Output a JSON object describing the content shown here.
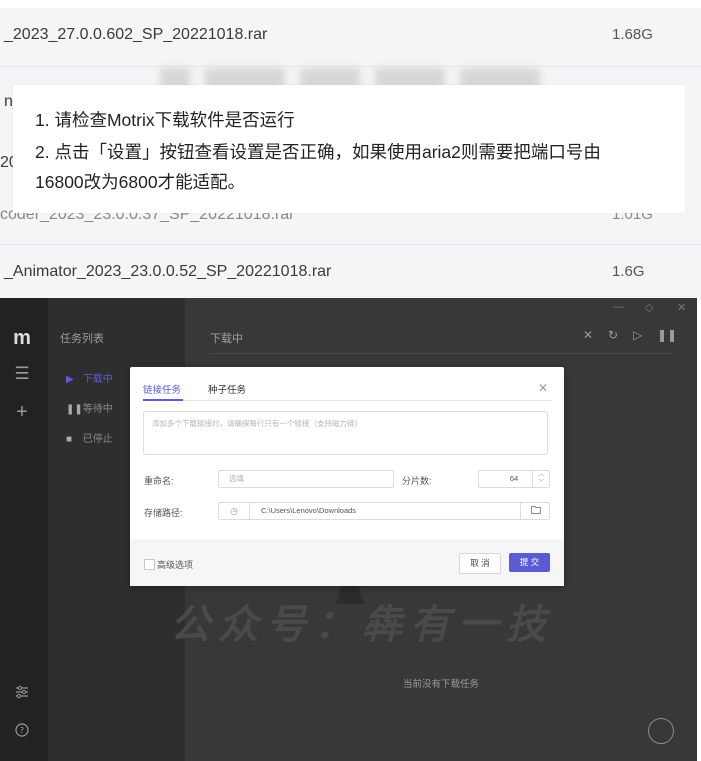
{
  "file_list": {
    "rows": [
      {
        "name": "_2023_27.0.0.602_SP_20221018.rar",
        "size": "1.68G"
      },
      {
        "name": "n_",
        "size": ""
      },
      {
        "name": "20",
        "size": ""
      },
      {
        "name": "coder_2023_23.0.0.37_SP_20221018.rar",
        "size": "1.01G"
      },
      {
        "name": "_Animator_2023_23.0.0.52_SP_20221018.rar",
        "size": "1.6G"
      }
    ]
  },
  "notice": {
    "line1": "1. 请检查Motrix下载软件是否运行",
    "line2": "2. 点击「设置」按钮查看设置是否正确，如果使用aria2则需要把端口号由",
    "line3": "16800改为6800才能适配。"
  },
  "app": {
    "logo": "m",
    "sidebar_icons": [
      "menu-icon",
      "add-icon",
      "settings-sliders-icon",
      "help-icon"
    ],
    "task_panel_title": "任务列表",
    "task_items": [
      {
        "label": "下载中",
        "icon": "play-icon",
        "active": true
      },
      {
        "label": "等待中",
        "icon": "pause-icon",
        "active": false
      },
      {
        "label": "已停止",
        "icon": "stop-icon",
        "active": false
      }
    ],
    "main_title": "下载中",
    "empty_text": "当前没有下载任务",
    "watermark": "公众号：犇有一技",
    "colors": {
      "accent": "#5b5bd6",
      "sidebar": "#222222",
      "panel": "#2e2e2e",
      "main": "#383838"
    }
  },
  "dialog": {
    "tabs": [
      "链接任务",
      "种子任务"
    ],
    "active_tab": "链接任务",
    "link_placeholder": "添加多个下载链接时，请确保每行只有一个链接（支持磁力链）",
    "rename_label": "重命名:",
    "rename_placeholder": "选填",
    "split_label": "分片数:",
    "split_value": "64",
    "path_label": "存储路径:",
    "path_value": "C:\\Users\\Lenovo\\Downloads",
    "advanced_label": "高级选项",
    "cancel_label": "取 消",
    "submit_label": "提 交"
  }
}
